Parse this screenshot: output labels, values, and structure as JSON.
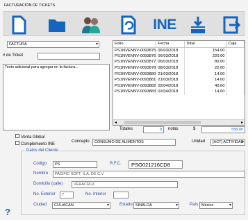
{
  "window": {
    "title": "FACTURACIÓN DE TICKETS"
  },
  "toolbar": {
    "buttons": [
      {
        "name": "new-document-icon"
      },
      {
        "name": "folder-icon"
      },
      {
        "name": "users-icon"
      },
      {
        "name": "refresh-document-icon"
      },
      {
        "name": "ine-button",
        "label": "INE"
      },
      {
        "name": "print-icon"
      },
      {
        "name": "exit-icon"
      }
    ]
  },
  "left": {
    "doc_type": "FACTURA",
    "ticket_label": "# de Ticket",
    "ticket_value": "",
    "notes": "Texto adicional para agregar en la factura..."
  },
  "grid": {
    "columns": [
      "Folio",
      "Fecha",
      "Total",
      "Caja"
    ],
    "rows": [
      [
        "PS1NVENNV-0093875",
        "06/03/2018",
        "154.00",
        ""
      ],
      [
        "PS1NVENNV-0093876",
        "06/03/2018",
        "220.00",
        ""
      ],
      [
        "PS1NVENNV-0093877",
        "06/03/2018",
        "80.00",
        ""
      ],
      [
        "PS1NVENNV-0093878",
        "08/03/2018",
        "22.00",
        ""
      ],
      [
        "PS1NVENNV-0093880",
        "21/03/2018",
        "14.00",
        ""
      ],
      [
        "PS1NVENNV-0093881",
        "21/03/2018",
        "14.00",
        ""
      ],
      [
        "PS1NVENNV-0093882",
        "02/04/2018",
        "40.00",
        ""
      ],
      [
        "PS1NVENNV-0093883",
        "02/04/2018",
        "14.00",
        ""
      ]
    ]
  },
  "totals": {
    "label": "Totales",
    "count": "8",
    "notas_label": "notas",
    "currency": "$",
    "amount": "558.00"
  },
  "options": {
    "venta_global": "Venta Global",
    "complemento_ine": "Complemento INE"
  },
  "concepto": {
    "label": "Concepto",
    "value": "CONSUMO DE ALIMENTOS"
  },
  "unidad": {
    "label": "Unidad",
    "value": "[ACT] ACTIVIDAD"
  },
  "cliente": {
    "section_title": "Datos del Cliente",
    "codigo_label": "Código",
    "codigo_value": "PS",
    "rfc_label": "R.F.C.",
    "rfc_value": "PSO021216CD8",
    "nombre_label": "Nombre",
    "nombre_value": "PACIFIC SOFT, S.A. DE C.V",
    "domicilio_label": "Domicilio (calle)",
    "domicilio_value": "VERACRUZ",
    "ext_label": "No. Exterior",
    "ext_value": "7",
    "int_label": "No. Interior",
    "int_value": "",
    "ciudad_label": "Ciudad",
    "ciudad_value": "CULIACÁN",
    "estado_label": "Estado",
    "estado_value": "SINALOA",
    "pais_label": "País",
    "pais_value": "México"
  },
  "help": "?"
}
